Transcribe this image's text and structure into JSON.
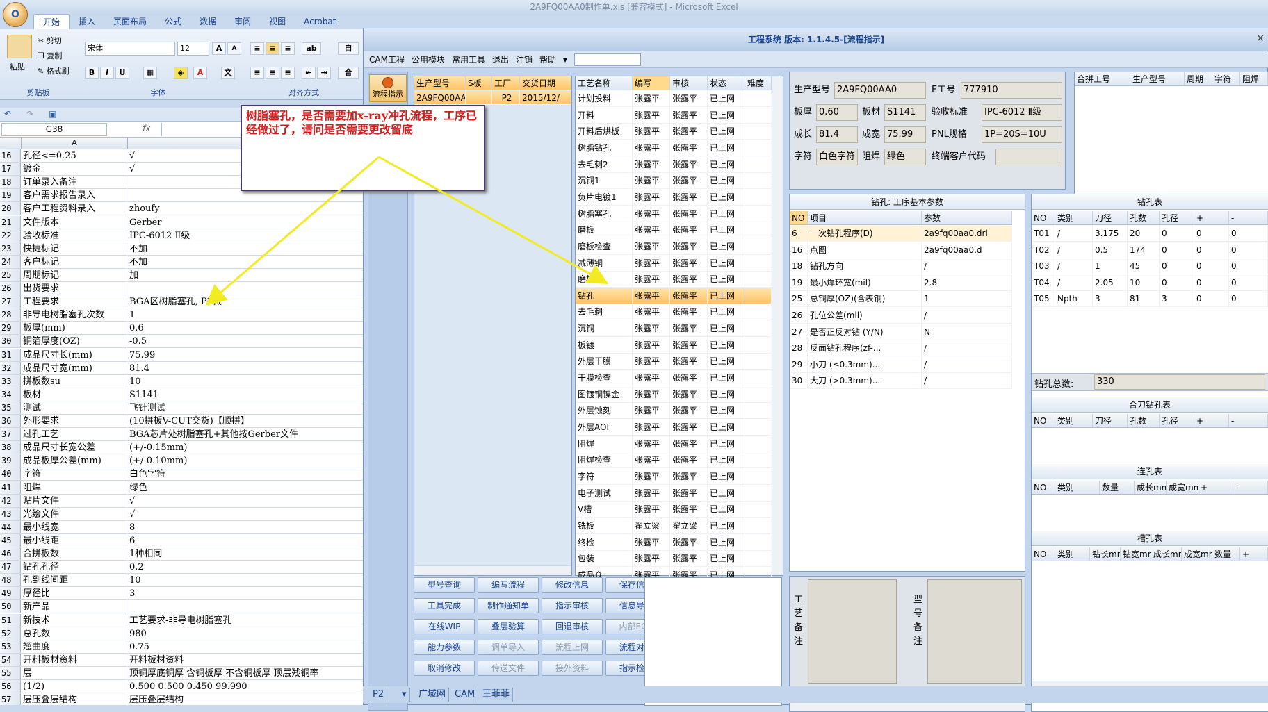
{
  "window_title": "2A9FQ00AA0制作单.xls [兼容模式] - Microsoft Excel",
  "office_button": "O",
  "ribbon": {
    "tabs": [
      "开始",
      "插入",
      "页面布局",
      "公式",
      "数据",
      "审阅",
      "视图",
      "Acrobat"
    ],
    "paste": "粘贴",
    "cut": "剪切",
    "copy": "复制",
    "format_painter": "格式刷",
    "font_name": "宋体",
    "font_size": "12",
    "group_clipboard": "剪贴板",
    "group_font": "字体",
    "group_align": "对齐方式",
    "bold": "B",
    "italic": "I",
    "underline": "U",
    "grow_font": "A",
    "shrink_font": "A",
    "wrap": "自",
    "merge": "合"
  },
  "name_box": "G38",
  "formula_fx": "fx",
  "sheet": {
    "col_a": "A",
    "rows": [
      {
        "n": "16",
        "a": "孔径<=0.25",
        "b": "√"
      },
      {
        "n": "17",
        "a": "镀金",
        "b": "√"
      },
      {
        "n": "18",
        "a": "订单录入备注",
        "b": ""
      },
      {
        "n": "19",
        "a": "客户需求报告录入",
        "b": ""
      },
      {
        "n": "20",
        "a": "客户工程资料录入",
        "b": "zhoufy"
      },
      {
        "n": "21",
        "a": "文件版本",
        "b": "Gerber"
      },
      {
        "n": "22",
        "a": "验收标准",
        "b": "IPC-6012 Ⅱ级"
      },
      {
        "n": "23",
        "a": "快捷标记",
        "b": "不加"
      },
      {
        "n": "24",
        "a": "客户标记",
        "b": "不加"
      },
      {
        "n": "25",
        "a": "周期标记",
        "b": "加"
      },
      {
        "n": "26",
        "a": "出货要求",
        "b": ""
      },
      {
        "n": "27",
        "a": "工程要求",
        "b": "BGA区树脂塞孔, P2做"
      },
      {
        "n": "28",
        "a": "非导电树脂塞孔次数",
        "b": "1"
      },
      {
        "n": "29",
        "a": "板厚(mm)",
        "b": "0.6"
      },
      {
        "n": "30",
        "a": "铜箔厚度(OZ)",
        "b": "-0.5"
      },
      {
        "n": "31",
        "a": "成品尺寸长(mm)",
        "b": "75.99"
      },
      {
        "n": "32",
        "a": "成品尺寸宽(mm)",
        "b": "81.4"
      },
      {
        "n": "33",
        "a": "拼板数su",
        "b": "10"
      },
      {
        "n": "34",
        "a": "板材",
        "b": "S1141"
      },
      {
        "n": "35",
        "a": "测试",
        "b": "飞针测试"
      },
      {
        "n": "36",
        "a": "外形要求",
        "b": "(10拼板V-CUT交货)【顺拼】"
      },
      {
        "n": "37",
        "a": "过孔工艺",
        "b": "BGA芯片处树脂塞孔+其他按Gerber文件"
      },
      {
        "n": "38",
        "a": "成品尺寸长宽公差",
        "b": "(+/-0.15mm)"
      },
      {
        "n": "39",
        "a": "成品板厚公差(mm)",
        "b": "(+/-0.10mm)"
      },
      {
        "n": "40",
        "a": "字符",
        "b": "白色字符"
      },
      {
        "n": "41",
        "a": "阻焊",
        "b": "绿色"
      },
      {
        "n": "42",
        "a": "贴片文件",
        "b": "√"
      },
      {
        "n": "43",
        "a": "光绘文件",
        "b": "√"
      },
      {
        "n": "44",
        "a": "最小线宽",
        "b": "8"
      },
      {
        "n": "45",
        "a": "最小线距",
        "b": "6"
      },
      {
        "n": "46",
        "a": "合拼板数",
        "b": "1种相同"
      },
      {
        "n": "47",
        "a": "钻孔孔径",
        "b": "0.2"
      },
      {
        "n": "48",
        "a": "孔到线间距",
        "b": "10"
      },
      {
        "n": "49",
        "a": "厚径比",
        "b": "3"
      },
      {
        "n": "50",
        "a": "新产品",
        "b": ""
      },
      {
        "n": "51",
        "a": "新技术",
        "b": "工艺要求-非导电树脂塞孔"
      },
      {
        "n": "52",
        "a": "总孔数",
        "b": "980"
      },
      {
        "n": "53",
        "a": "翘曲度",
        "b": "0.75"
      },
      {
        "n": "54",
        "a": "开料板材资料",
        "b": "开料板材资料"
      },
      {
        "n": "55",
        "a": "层",
        "b": "顶铜厚底铜厚 含铜板厚 不含铜板厚 顶层残铜率"
      },
      {
        "n": "56",
        "a": "(1/2)",
        "b": "0.500  0.500        0.450        99.990"
      },
      {
        "n": "57",
        "a": "层压叠层结构",
        "b": "层压叠层结构"
      }
    ]
  },
  "callout": "树脂塞孔，是否需要加x-ray冲孔流程，工序已经做过了，请问是否需要更改留底",
  "app": {
    "title": "工程系统 版本: 1.1.4.5-[流程指示]",
    "close": "×",
    "menu": [
      "CAM工程",
      "公用模块",
      "常用工具",
      "退出",
      "注销",
      "帮助"
    ],
    "flow_button": "流程指示",
    "orders": {
      "headers": [
        "生产型号",
        "S板",
        "工厂",
        "交货日期"
      ],
      "rows": [
        {
          "model": "2A9FQ00AA0",
          "s": "",
          "factory": "P2",
          "date": "2015/12/"
        }
      ]
    },
    "process": {
      "headers": [
        "工艺名称",
        "编写",
        "审核",
        "状态",
        "难度"
      ],
      "rows": [
        [
          "计划投料",
          "张露平",
          "张露平",
          "已上网"
        ],
        [
          "开料",
          "张露平",
          "张露平",
          "已上网"
        ],
        [
          "开料后烘板",
          "张露平",
          "张露平",
          "已上网"
        ],
        [
          "树脂钻孔",
          "张露平",
          "张露平",
          "已上网"
        ],
        [
          "去毛刺2",
          "张露平",
          "张露平",
          "已上网"
        ],
        [
          "沉铜1",
          "张露平",
          "张露平",
          "已上网"
        ],
        [
          "负片电镀1",
          "张露平",
          "张露平",
          "已上网"
        ],
        [
          "树脂塞孔",
          "张露平",
          "张露平",
          "已上网"
        ],
        [
          "磨板",
          "张露平",
          "张露平",
          "已上网"
        ],
        [
          "磨板检查",
          "张露平",
          "张露平",
          "已上网"
        ],
        [
          "减薄铜",
          "张露平",
          "张露平",
          "已上网"
        ],
        [
          "磨板1",
          "张露平",
          "张露平",
          "已上网"
        ],
        [
          "钻孔",
          "张露平",
          "张露平",
          "已上网"
        ],
        [
          "去毛刺",
          "张露平",
          "张露平",
          "已上网"
        ],
        [
          "沉铜",
          "张露平",
          "张露平",
          "已上网"
        ],
        [
          "板镀",
          "张露平",
          "张露平",
          "已上网"
        ],
        [
          "外层干膜",
          "张露平",
          "张露平",
          "已上网"
        ],
        [
          "干膜检查",
          "张露平",
          "张露平",
          "已上网"
        ],
        [
          "图镀铜镍金",
          "张露平",
          "张露平",
          "已上网"
        ],
        [
          "外层蚀刻",
          "张露平",
          "张露平",
          "已上网"
        ],
        [
          "外层AOI",
          "张露平",
          "张露平",
          "已上网"
        ],
        [
          "阻焊",
          "张露平",
          "张露平",
          "已上网"
        ],
        [
          "阻焊检查",
          "张露平",
          "张露平",
          "已上网"
        ],
        [
          "字符",
          "张露平",
          "张露平",
          "已上网"
        ],
        [
          "电子测试",
          "张露平",
          "张露平",
          "已上网"
        ],
        [
          "V槽",
          "张露平",
          "张露平",
          "已上网"
        ],
        [
          "铣板",
          "翟立梁",
          "翟立梁",
          "已上网"
        ],
        [
          "终检",
          "张露平",
          "张露平",
          "已上网"
        ],
        [
          "包装",
          "张露平",
          "张露平",
          "已上网"
        ],
        [
          "成品仓",
          "张露平",
          "张露平",
          "已上网"
        ]
      ]
    },
    "buttons": [
      [
        "型号查询",
        "编写流程",
        "修改信息",
        "保存信息"
      ],
      [
        "工具完成",
        "制作通知单",
        "指示审核",
        "信息导入"
      ],
      [
        "在线WIP",
        "叠层验算",
        "回退审核",
        "内部ECN"
      ],
      [
        "能力参数",
        "调单导入",
        "流程上网",
        "流程对比"
      ],
      [
        "取消修改",
        "传送文件",
        "接外资料",
        "指示检查"
      ]
    ],
    "info": {
      "model_label": "生产型号",
      "model": "2A9FQ00AA0",
      "eno_label": "E工号",
      "eno": "777910",
      "thick_label": "板厚",
      "thick": "0.60",
      "mat_label": "板材",
      "mat": "S1141",
      "std_label": "验收标准",
      "std": "IPC-6012 Ⅱ级",
      "len_label": "成长",
      "len": "81.4",
      "wid_label": "成宽",
      "wid": "75.99",
      "pnl_label": "PNL规格",
      "pnl": "1P=20S=10U",
      "char_label": "字符",
      "char": "白色字符",
      "mask_label": "阻焊",
      "mask": "绿色",
      "cust_label": "终端客户代码",
      "cust": ""
    },
    "merge_headers": [
      "合拼工号",
      "生产型号",
      "周期",
      "字符",
      "阻焊"
    ],
    "drill_params": {
      "title": "钻孔: 工序基本参数",
      "headers": [
        "NO",
        "项目",
        "参数"
      ],
      "rows": [
        [
          "6",
          "一次钻孔程序(D)",
          "2a9fq00aa0.drl"
        ],
        [
          "16",
          "点图",
          "2a9fq00aa0.d"
        ],
        [
          "18",
          "钻孔方向",
          "/"
        ],
        [
          "19",
          "最小焊环宽(mil)",
          "2.8"
        ],
        [
          "25",
          "总铜厚(OZ)(含表铜)",
          "1"
        ],
        [
          "26",
          "孔位公差(mil)",
          "/"
        ],
        [
          "27",
          "是否正反对钻 (Y/N)",
          "N"
        ],
        [
          "28",
          "反面钻孔程序(zf-...",
          "/"
        ],
        [
          "29",
          "小刀 (≤0.3mm)...",
          "/"
        ],
        [
          "30",
          "大刀 (>0.3mm)...",
          "/"
        ]
      ]
    },
    "process_note": "工艺备注",
    "model_note": "型号备注",
    "drill_table": {
      "title": "钻孔表",
      "headers": [
        "NO",
        "类别",
        "刀径",
        "孔数",
        "孔径",
        "+",
        "-"
      ],
      "rows": [
        [
          "T01",
          "/",
          "3.175",
          "20",
          "0",
          "0",
          "0"
        ],
        [
          "T02",
          "/",
          "0.5",
          "174",
          "0",
          "0",
          "0"
        ],
        [
          "T03",
          "/",
          "1",
          "45",
          "0",
          "0",
          "0"
        ],
        [
          "T04",
          "/",
          "2.05",
          "10",
          "0",
          "0",
          "0"
        ],
        [
          "T05",
          "Npth",
          "3",
          "81",
          "3",
          "0",
          "0"
        ]
      ],
      "total_label": "钻孔总数:",
      "total": "330"
    },
    "combo_drill": {
      "title": "合刀钻孔表",
      "headers": [
        "NO",
        "类别",
        "刀径",
        "孔数",
        "孔径",
        "+",
        "-"
      ]
    },
    "link_holes": {
      "title": "连孔表",
      "headers": [
        "NO",
        "类别",
        "数量",
        "成长mm",
        "成宽mm",
        "+",
        "-"
      ]
    },
    "slot_holes": {
      "title": "槽孔表",
      "headers": [
        "NO",
        "类别",
        "钻长mm",
        "钻宽mm",
        "成长mm",
        "成宽mm",
        "数量",
        "+"
      ]
    },
    "status_tabs": [
      "P2",
      "广域网",
      "CAM",
      "王菲菲"
    ]
  }
}
